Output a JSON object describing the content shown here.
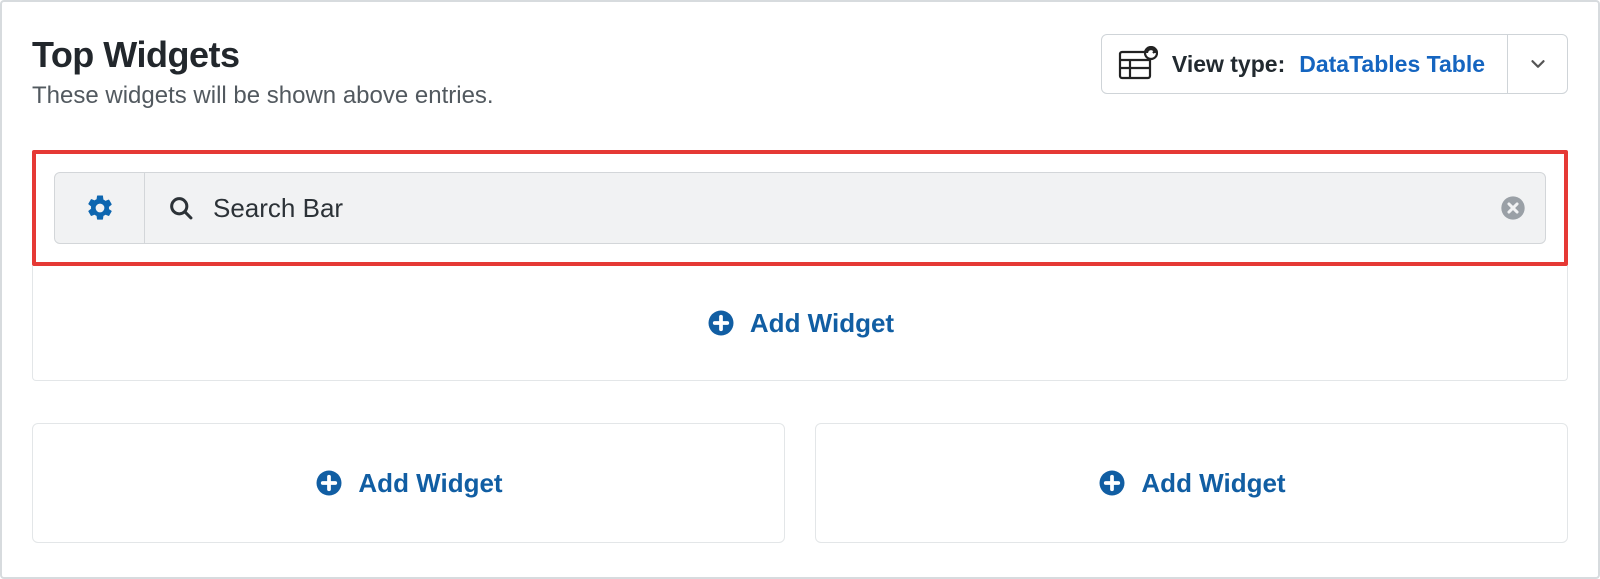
{
  "header": {
    "title": "Top Widgets",
    "subtitle": "These widgets will be shown above entries."
  },
  "view_type": {
    "label": "View type:",
    "value": "DataTables Table"
  },
  "widget_row": {
    "name": "Search Bar"
  },
  "add_widget_label": "Add Widget",
  "colors": {
    "accent_blue": "#115ea3",
    "link_blue": "#1565c0",
    "highlight_red": "#e53935",
    "gear_blue": "#0d66b0"
  }
}
